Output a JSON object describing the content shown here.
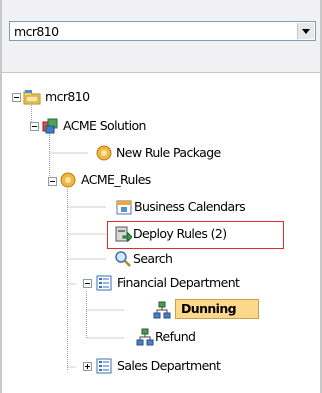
{
  "project_selector": {
    "value": "mcr810"
  },
  "tree": {
    "root": {
      "label": "mcr810"
    },
    "solution": {
      "label": "ACME Solution"
    },
    "new_rule_package": {
      "label": "New Rule Package"
    },
    "acme_rules": {
      "label": "ACME_Rules"
    },
    "business_calendars": {
      "label": "Business Calendars"
    },
    "deploy_rules": {
      "label": "Deploy Rules (2)"
    },
    "search": {
      "label": "Search"
    },
    "financial_department": {
      "label": "Financial Department"
    },
    "dunning": {
      "label": "Dunning"
    },
    "refund": {
      "label": "Refund"
    },
    "sales_department": {
      "label": "Sales Department"
    }
  },
  "colors": {
    "selection": "#fcd98a",
    "highlight_border": "#e32b2b"
  }
}
